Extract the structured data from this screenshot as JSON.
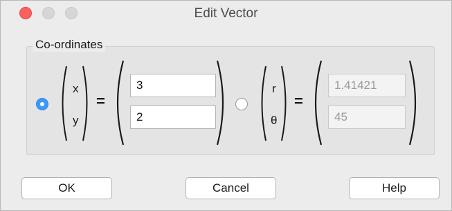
{
  "window": {
    "title": "Edit Vector"
  },
  "group": {
    "label": "Co-ordinates"
  },
  "cartesian": {
    "selected": true,
    "x_label": "x",
    "y_label": "y",
    "equals": "=",
    "x_value": "3",
    "y_value": "2"
  },
  "polar": {
    "selected": false,
    "r_label": "r",
    "theta_label": "θ",
    "equals": "=",
    "r_value": "1.41421",
    "theta_value": "45"
  },
  "buttons": {
    "ok": "OK",
    "cancel": "Cancel",
    "help": "Help"
  },
  "colors": {
    "accent": "#3b99fc",
    "close": "#fc605c"
  }
}
